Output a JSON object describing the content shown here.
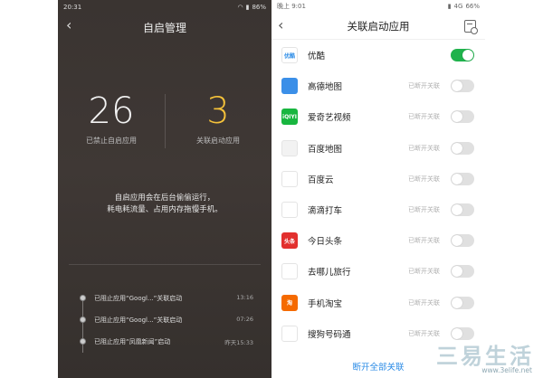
{
  "left": {
    "statusbar": {
      "time": "20:31",
      "battery": "86%"
    },
    "title": "自启管理",
    "stats": [
      {
        "value": "26",
        "label": "已禁止自启应用"
      },
      {
        "value": "3",
        "label": "关联启动应用"
      }
    ],
    "description": [
      "自启应用会在后台偷偷运行，",
      "耗电耗流量、占用内存拖慢手机。"
    ],
    "timeline": [
      {
        "text": "已阻止应用“Googl...”关联启动",
        "time": "13:16"
      },
      {
        "text": "已阻止应用“Googl...”关联启动",
        "time": "07:26"
      },
      {
        "text": "已阻止应用“凤凰新闻”启动",
        "time": "昨天15:33"
      }
    ]
  },
  "right": {
    "statusbar": {
      "time": "晚上 9:01",
      "network": "4G",
      "battery": "66%"
    },
    "title": "关联启动应用",
    "apps": [
      {
        "name": "优酷",
        "status": "",
        "on": true,
        "icon": "youku-icon",
        "icon_text": "优酷",
        "color": "#ffffff"
      },
      {
        "name": "高德地图",
        "status": "已断开关联",
        "on": false,
        "icon": "amap-icon",
        "icon_text": "",
        "color": "#3b8fe8"
      },
      {
        "name": "爱奇艺视频",
        "status": "已断开关联",
        "on": false,
        "icon": "iqiyi-icon",
        "icon_text": "iQIYI",
        "color": "#18b63f"
      },
      {
        "name": "百度地图",
        "status": "已断开关联",
        "on": false,
        "icon": "baidu-map-icon",
        "icon_text": "",
        "color": "#f2f2f2"
      },
      {
        "name": "百度云",
        "status": "已断开关联",
        "on": false,
        "icon": "baidu-cloud-icon",
        "icon_text": "",
        "color": "#ffffff"
      },
      {
        "name": "滴滴打车",
        "status": "已断开关联",
        "on": false,
        "icon": "didi-icon",
        "icon_text": "",
        "color": "#ffffff"
      },
      {
        "name": "今日头条",
        "status": "已断开关联",
        "on": false,
        "icon": "toutiao-icon",
        "icon_text": "头条",
        "color": "#e2302e"
      },
      {
        "name": "去哪儿旅行",
        "status": "已断开关联",
        "on": false,
        "icon": "qunar-icon",
        "icon_text": "",
        "color": "#ffffff"
      },
      {
        "name": "手机淘宝",
        "status": "已断开关联",
        "on": false,
        "icon": "taobao-icon",
        "icon_text": "淘",
        "color": "#f56a00"
      },
      {
        "name": "搜狗号码通",
        "status": "已断开关联",
        "on": false,
        "icon": "sogou-icon",
        "icon_text": "",
        "color": "#ffffff"
      }
    ],
    "footer": "断开全部关联"
  },
  "watermark": {
    "main": "三易生活",
    "url": "www.3elife.net"
  }
}
